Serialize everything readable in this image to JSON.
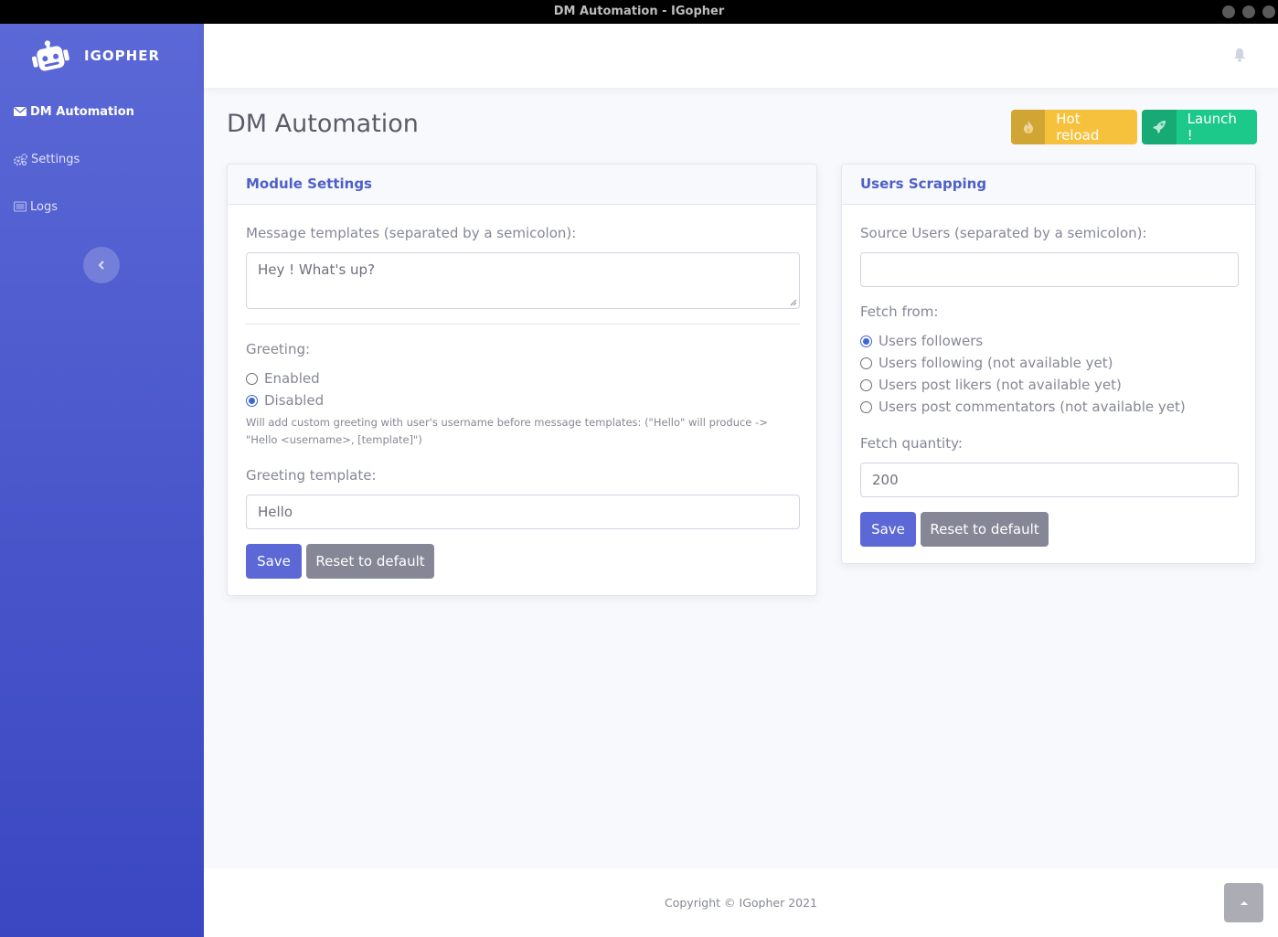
{
  "window": {
    "title": "DM Automation - IGopher"
  },
  "brand": {
    "name": "IGOPHER"
  },
  "sidebar": {
    "items": [
      {
        "label": "DM Automation",
        "icon": "envelope-icon"
      },
      {
        "label": "Settings",
        "icon": "cogs-icon"
      },
      {
        "label": "Logs",
        "icon": "list-icon"
      }
    ]
  },
  "header": {
    "title": "DM Automation",
    "hot_reload_label": "Hot reload",
    "launch_label": "Launch !"
  },
  "module_settings": {
    "title": "Module Settings",
    "message_templates_label": "Message templates (separated by a semicolon):",
    "message_templates_value": "Hey ! What's up?",
    "greeting_label": "Greeting:",
    "greeting_options": [
      {
        "label": "Enabled",
        "checked": false
      },
      {
        "label": "Disabled",
        "checked": true
      }
    ],
    "greeting_help_line1": "Will add custom greeting with user's username before message templates: (\"Hello\" will produce ->",
    "greeting_help_line2": "\"Hello <username>, [template]\")",
    "greeting_template_label": "Greeting template:",
    "greeting_template_value": "Hello",
    "save_label": "Save",
    "reset_label": "Reset to default"
  },
  "users_scrapping": {
    "title": "Users Scrapping",
    "source_users_label": "Source Users (separated by a semicolon):",
    "source_users_value": "",
    "fetch_from_label": "Fetch from:",
    "fetch_options": [
      {
        "label": "Users followers",
        "checked": true
      },
      {
        "label": "Users following (not available yet)",
        "checked": false
      },
      {
        "label": "Users post likers (not available yet)",
        "checked": false
      },
      {
        "label": "Users post commentators (not available yet)",
        "checked": false
      }
    ],
    "fetch_quantity_label": "Fetch quantity:",
    "fetch_quantity_value": "200",
    "save_label": "Save",
    "reset_label": "Reset to default"
  },
  "footer": {
    "copyright": "Copyright © IGopher 2021"
  },
  "colors": {
    "primary": "#5b68d6",
    "warning": "#f6c23e",
    "success": "#1cc88a",
    "secondary": "#858796"
  }
}
